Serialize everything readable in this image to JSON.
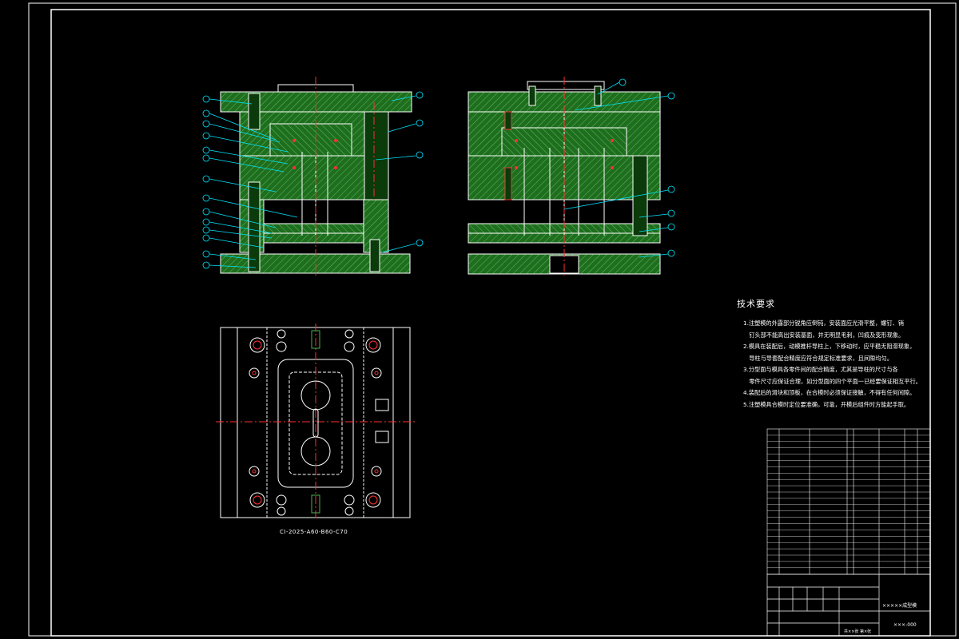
{
  "technical_requirements": {
    "title": "技术要求",
    "items": [
      "1.注塑模的外露部分锐角应倒钝，安装面应光滑平整，螺钉、销",
      "　钉头部不能高出安装基面，并无明显毛刺，凹痕及变形现象。",
      "2.模具在装配后，动模推杆导柱上，下移动时，应平稳无阻滞现象，",
      "　导柱与导套配合精度应符合规定标准要求，且间隙均匀。",
      "3.分型面与模具各零件间的配合精度，尤其是导柱的尺寸与各",
      "　零件尺寸应保证合理，如分型面的四个平面一已经要保证相互平行。",
      "4.装配后的滑块和顶板，在合模时必须保证接触，不得有任何间隙。",
      "5.注塑模具合模时定位要准确，可靠，开模后组件时方能起手取。"
    ]
  },
  "plan_view": {
    "label": "CI-2025-A60-B60-C70"
  },
  "title_block": {
    "drawing_name": "×××××成型模",
    "drawing_no": "×××-000",
    "sheet": "共××张  第×张"
  },
  "colors": {
    "background": "#000000",
    "section_fill": "#1a6b1a",
    "hatch": "#5cbd5c",
    "outline": "#ffffff",
    "centerline": "#ff3030",
    "leader": "#00e5ff",
    "parts_red": "#ff2a2a"
  }
}
